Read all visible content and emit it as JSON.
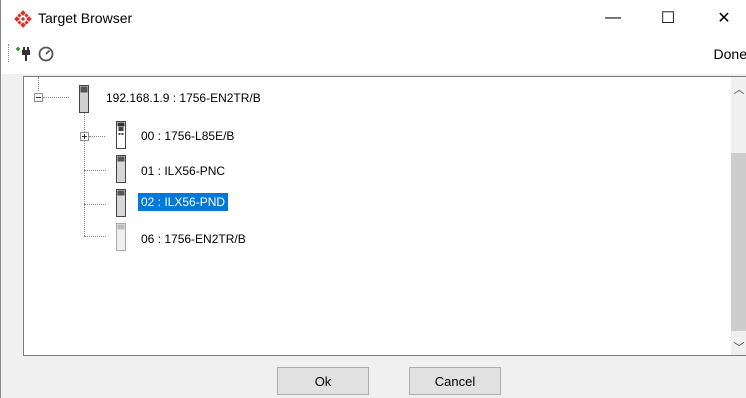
{
  "window": {
    "title": "Target Browser"
  },
  "title_controls": {
    "minimize": "—",
    "maximize": "☐",
    "close": "✕"
  },
  "toolbar": {
    "icons": [
      "connect-plug-icon",
      "refresh-icon"
    ],
    "done_label": "Done"
  },
  "tree": {
    "root": {
      "label": "192.168.1.9 : 1756-EN2TR/B",
      "expanded": true
    },
    "children": [
      {
        "label": "00 : 1756-L85E/B",
        "has_children": true,
        "selected": false
      },
      {
        "label": "01 : ILX56-PNC",
        "has_children": false,
        "selected": false
      },
      {
        "label": "02 : ILX56-PND",
        "has_children": false,
        "selected": true
      },
      {
        "label": "06 : 1756-EN2TR/B",
        "has_children": false,
        "selected": false
      }
    ]
  },
  "buttons": {
    "ok": "Ok",
    "cancel": "Cancel"
  },
  "colors": {
    "selection": "#0078d7",
    "logo": "#d8342c"
  }
}
